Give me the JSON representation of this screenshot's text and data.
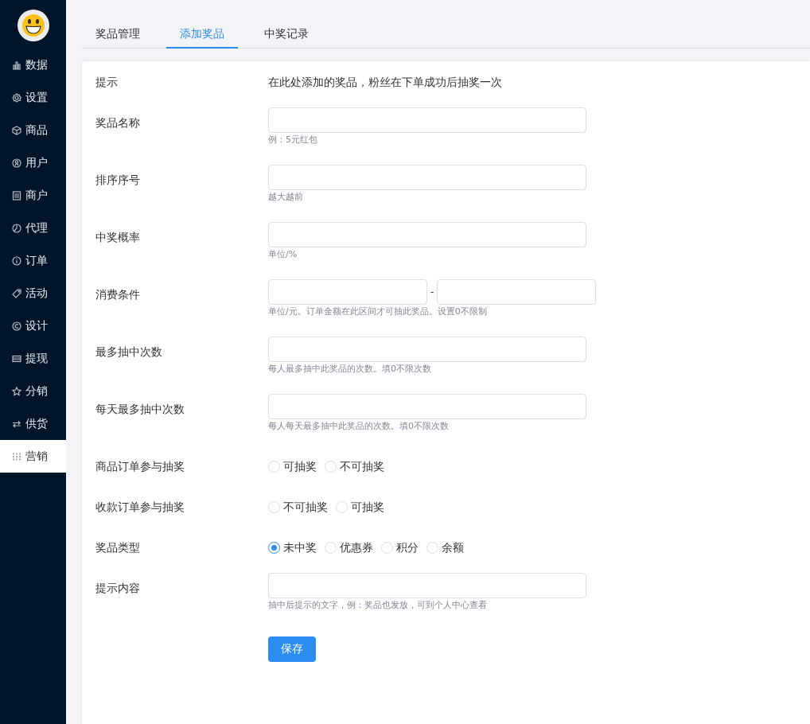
{
  "sidebar": {
    "items": [
      {
        "label": "数据",
        "selected": false
      },
      {
        "label": "设置",
        "selected": false
      },
      {
        "label": "商品",
        "selected": false
      },
      {
        "label": "用户",
        "selected": false
      },
      {
        "label": "商户",
        "selected": false
      },
      {
        "label": "代理",
        "selected": false
      },
      {
        "label": "订单",
        "selected": false
      },
      {
        "label": "活动",
        "selected": false
      },
      {
        "label": "设计",
        "selected": false
      },
      {
        "label": "提现",
        "selected": false
      },
      {
        "label": "分销",
        "selected": false
      },
      {
        "label": "供货",
        "selected": false
      },
      {
        "label": "营销",
        "selected": true
      }
    ]
  },
  "tabs": [
    {
      "label": "奖品管理",
      "selected": false
    },
    {
      "label": "添加奖品",
      "selected": true
    },
    {
      "label": "中奖记录",
      "selected": false
    }
  ],
  "form": {
    "rows": [
      {
        "kind": "text",
        "label": "提示",
        "value": "在此处添加的奖品，粉丝在下单成功后抽奖一次"
      },
      {
        "kind": "input",
        "label": "奖品名称",
        "help": "例：5元红包"
      },
      {
        "kind": "input",
        "label": "排序序号",
        "help": "越大越前"
      },
      {
        "kind": "input",
        "label": "中奖概率",
        "help": "单位/%"
      },
      {
        "kind": "range",
        "label": "消费条件",
        "separator": "-",
        "help": "单位/元。订单金额在此区间才可抽此奖品。设置0不限制"
      },
      {
        "kind": "input",
        "label": "最多抽中次数",
        "help": "每人最多抽中此奖品的次数。填0不限次数"
      },
      {
        "kind": "input",
        "label": "每天最多抽中次数",
        "help": "每人每天最多抽中此奖品的次数。填0不限次数"
      },
      {
        "kind": "radio",
        "label": "商品订单参与抽奖",
        "options": [
          {
            "label": "可抽奖",
            "selected": false
          },
          {
            "label": "不可抽奖",
            "selected": false
          }
        ]
      },
      {
        "kind": "radio",
        "label": "收款订单参与抽奖",
        "options": [
          {
            "label": "不可抽奖",
            "selected": false
          },
          {
            "label": "可抽奖",
            "selected": false
          }
        ]
      },
      {
        "kind": "radio",
        "label": "奖品类型",
        "options": [
          {
            "label": "未中奖",
            "selected": true
          },
          {
            "label": "优惠券",
            "selected": false
          },
          {
            "label": "积分",
            "selected": false
          },
          {
            "label": "余额",
            "selected": false
          }
        ]
      },
      {
        "kind": "input",
        "label": "提示内容",
        "help": "抽中后提示的文字，例：奖品也发放，可到个人中心查看"
      }
    ],
    "submit": "保存"
  }
}
